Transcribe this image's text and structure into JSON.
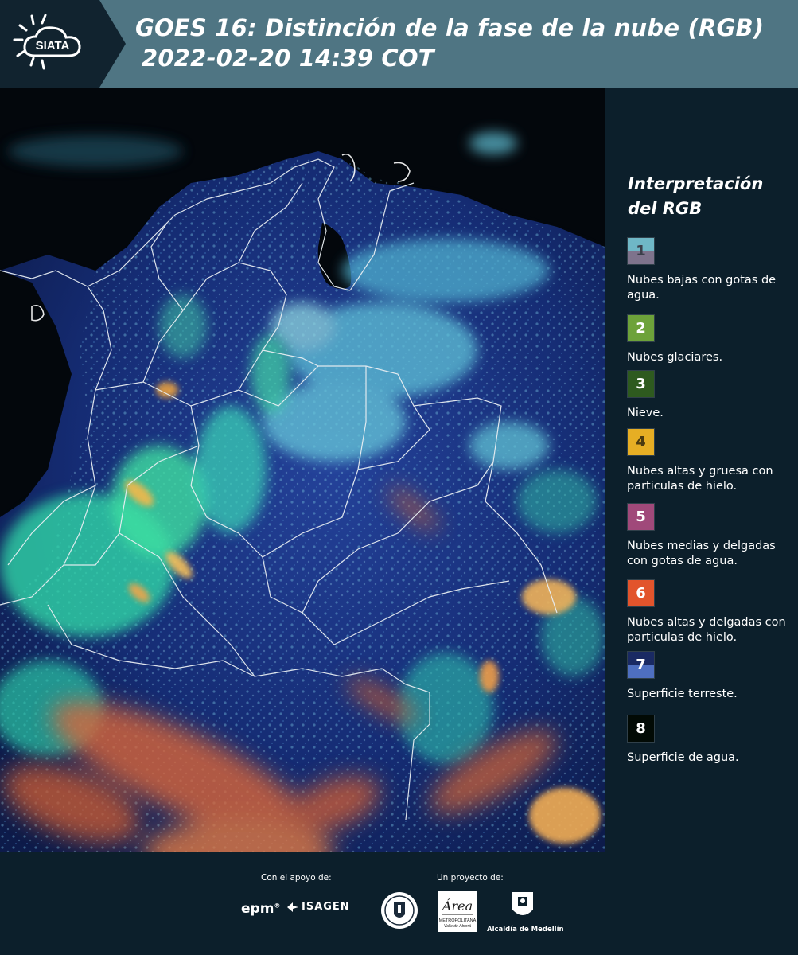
{
  "header": {
    "logo_text": "SIATA",
    "satellite": "GOES 16",
    "product": "Distinción de la fase de la nube (RGB)",
    "datetime": "2022-02-20 14:39 COT"
  },
  "legend": {
    "title_line1": "Interpretación",
    "title_line2": "del RGB",
    "items": [
      {
        "num": "1",
        "label": "Nubes bajas con gotas de agua.",
        "top_color": "#6fb7c6",
        "bottom_color": "#7e738c",
        "num_color": "#3b3f4a"
      },
      {
        "num": "2",
        "label": "Nubes glaciares.",
        "top_color": "#6da23a",
        "bottom_color": "#6da23a",
        "num_color": "#ffffff"
      },
      {
        "num": "3",
        "label": "Nieve.",
        "top_color": "#2e5a1f",
        "bottom_color": "#2e5a1f",
        "num_color": "#ffffff"
      },
      {
        "num": "4",
        "label": "Nubes altas y gruesa con particulas de hielo.",
        "top_color": "#e6ae24",
        "bottom_color": "#e6ae24",
        "num_color": "#4a3a10"
      },
      {
        "num": "5",
        "label": "Nubes medias y delgadas con gotas de agua.",
        "top_color": "#a0497a",
        "bottom_color": "#a0497a",
        "num_color": "#ffffff"
      },
      {
        "num": "6",
        "label": "Nubes altas y delgadas con particulas de hielo.",
        "top_color": "#e2542c",
        "bottom_color": "#e2542c",
        "num_color": "#ffffff"
      },
      {
        "num": "7",
        "label": "Superficie terreste.",
        "top_color": "#1a2a63",
        "bottom_color": "#4e6fc0",
        "num_color": "#ffffff"
      },
      {
        "num": "8",
        "label": "Superficie de agua.",
        "top_color": "#020a05",
        "bottom_color": "#020a05",
        "num_color": "#ffffff"
      }
    ]
  },
  "footer": {
    "support_label": "Con el apoyo de:",
    "project_label": "Un proyecto de:",
    "epm": "epm",
    "isagen": "ISAGEN",
    "area_text": "Área",
    "area_sub1": "METROPOLITANA",
    "area_sub2": "Valle de Aburrá",
    "medellin": "Alcaldía de Medellín"
  },
  "colors": {
    "header_bg": "#4f7583",
    "panel_bg": "#0c1f2b",
    "ocean": "#03070c",
    "land": "#16307a",
    "border": "#e8eef2"
  }
}
